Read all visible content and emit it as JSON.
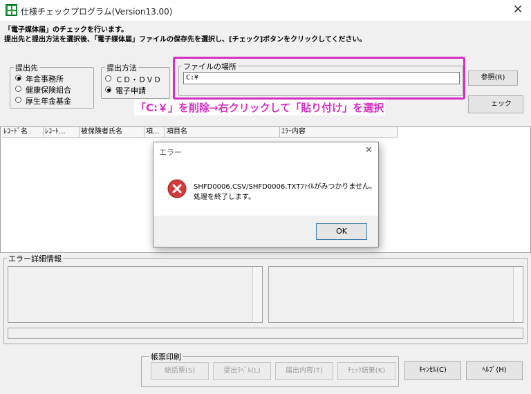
{
  "window": {
    "title": "仕様チェックプログラム(Version13.00)",
    "close_glyph": "✕"
  },
  "intro": {
    "line1": "「電子媒体届」のチェックを行います。",
    "line2": "提出先と提出方法を選択後、「電子媒体届」ファイルの保存先を選択し、[チェック]ボタンをクリックしてください。"
  },
  "destination": {
    "legend": "提出先",
    "options": [
      "年金事務所",
      "健康保険組合",
      "厚生年金基金"
    ],
    "selected": 0
  },
  "method": {
    "legend": "提出方法",
    "options": [
      "ＣＤ・ＤＶＤ",
      "電子申請"
    ],
    "selected": 1
  },
  "file_location": {
    "legend": "ファイルの場所",
    "value": "C:¥",
    "browse_label": "参照(R)"
  },
  "check_button": {
    "label": "ェック"
  },
  "annotation": {
    "text": "「C:￥」を削除→右クリックして「貼り付け」を選択",
    "color": "#d62ec2"
  },
  "table": {
    "columns": [
      "ﾚｺｰﾄﾞ名",
      "ﾚｺｰﾄ...",
      "被保険者氏名",
      "項...",
      "項目名",
      "ｴﾗｰ内容"
    ]
  },
  "error_detail": {
    "legend": "エラー詳細情報"
  },
  "print_group": {
    "legend": "帳票印刷",
    "buttons": [
      "総括票(S)",
      "提出ﾗﾍﾞﾙ(L)",
      "届出内容(T)",
      "ﾁｪｯｸ結果(K)"
    ]
  },
  "footer": {
    "cancel_label": "ｷｬﾝｾﾙ(C)",
    "help_label": "ﾍﾙﾌﾟ(H)"
  },
  "dialog": {
    "title": "エラー",
    "close_glyph": "✕",
    "message_line1": "SHFD0006.CSV/SHFD0006.TXTﾌｧｲﾙがみつかりません。",
    "message_line2": "処理を終了します。",
    "ok_label": "OK",
    "icon": "error-icon"
  }
}
